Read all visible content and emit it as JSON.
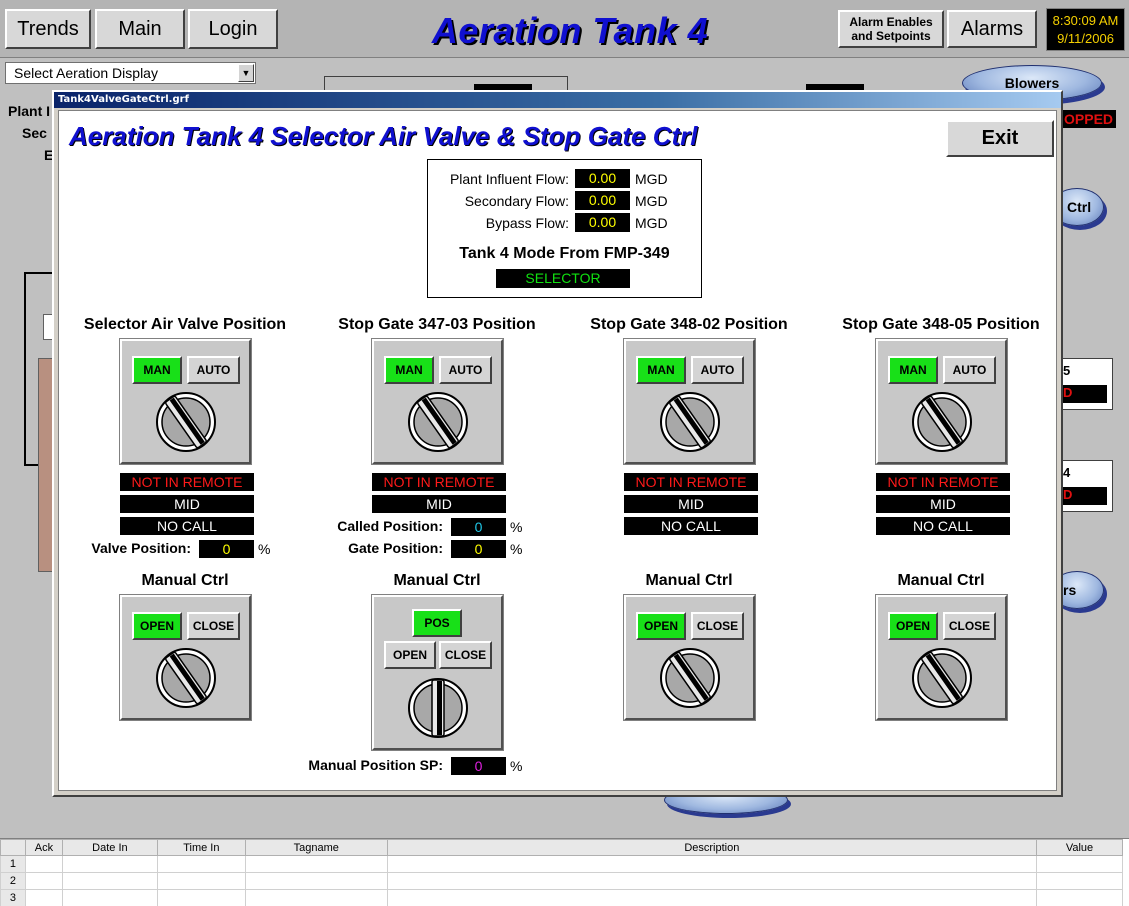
{
  "topbar": {
    "trends": "Trends",
    "main": "Main",
    "login": "Login",
    "title": "Aeration Tank 4",
    "alarm_enables_line1": "Alarm Enables",
    "alarm_enables_line2": "and Setpoints",
    "alarms": "Alarms",
    "time": "8:30:09 AM",
    "date": "9/11/2006"
  },
  "background": {
    "select_display": "Select Aeration Display",
    "blowers": "Blowers",
    "stopped": "OPPED",
    "label_plant": "Plant I",
    "label_sec": "Sec",
    "label_e": "E",
    "ctrl_fragment": "Ctrl",
    "rs_fragment": "rs",
    "num5": "5",
    "num4": "4",
    "d1": "D",
    "d2": "D"
  },
  "popup": {
    "window_title": "Tank4ValveGateCtrl.grf",
    "title": "Aeration Tank 4 Selector Air Valve & Stop Gate Ctrl",
    "exit": "Exit",
    "flows": [
      {
        "label": "Plant Influent Flow:",
        "value": "0.00",
        "unit": "MGD"
      },
      {
        "label": "Secondary Flow:",
        "value": "0.00",
        "unit": "MGD"
      },
      {
        "label": "Bypass Flow:",
        "value": "0.00",
        "unit": "MGD"
      }
    ],
    "mode_title": "Tank 4 Mode From FMP-349",
    "mode_value": "SELECTOR",
    "sections": [
      {
        "title": "Selector Air Valve Position",
        "man": "MAN",
        "auto": "AUTO",
        "status1": "NOT IN REMOTE",
        "status2": "MID",
        "status3": "NO CALL",
        "valve_label": "Valve Position:",
        "valve_value": "0",
        "valve_unit": "%",
        "manual_title": "Manual Ctrl",
        "open": "OPEN",
        "close": "CLOSE"
      },
      {
        "title": "Stop Gate 347-03 Position",
        "man": "MAN",
        "auto": "AUTO",
        "status1": "NOT IN REMOTE",
        "status2": "MID",
        "called_label": "Called Position:",
        "called_value": "0",
        "called_unit": "%",
        "gate_label": "Gate Position:",
        "gate_value": "0",
        "gate_unit": "%",
        "manual_title": "Manual Ctrl",
        "pos": "POS",
        "open": "OPEN",
        "close": "CLOSE",
        "sp_label": "Manual Position SP:",
        "sp_value": "0",
        "sp_unit": "%"
      },
      {
        "title": "Stop Gate 348-02 Position",
        "man": "MAN",
        "auto": "AUTO",
        "status1": "NOT IN REMOTE",
        "status2": "MID",
        "status3": "NO CALL",
        "manual_title": "Manual Ctrl",
        "open": "OPEN",
        "close": "CLOSE"
      },
      {
        "title": "Stop Gate 348-05 Position",
        "man": "MAN",
        "auto": "AUTO",
        "status1": "NOT IN REMOTE",
        "status2": "MID",
        "status3": "NO CALL",
        "manual_title": "Manual Ctrl",
        "open": "OPEN",
        "close": "CLOSE"
      }
    ]
  },
  "alarm_table": {
    "columns": [
      "",
      "Ack",
      "Date In",
      "Time In",
      "Tagname",
      "Description",
      "Value"
    ],
    "rows": [
      "1",
      "2",
      "3"
    ]
  },
  "colors": {
    "title_blue": "#1010d0",
    "active_green": "#18e018",
    "alarm_red": "#ff1a1a",
    "value_yellow": "#ffff00",
    "cyan_value": "#20c8e8",
    "magenta_value": "#e020e0"
  },
  "icons": {
    "knob": "rotary-selector-icon",
    "dropdown": "chevron-down-icon"
  }
}
